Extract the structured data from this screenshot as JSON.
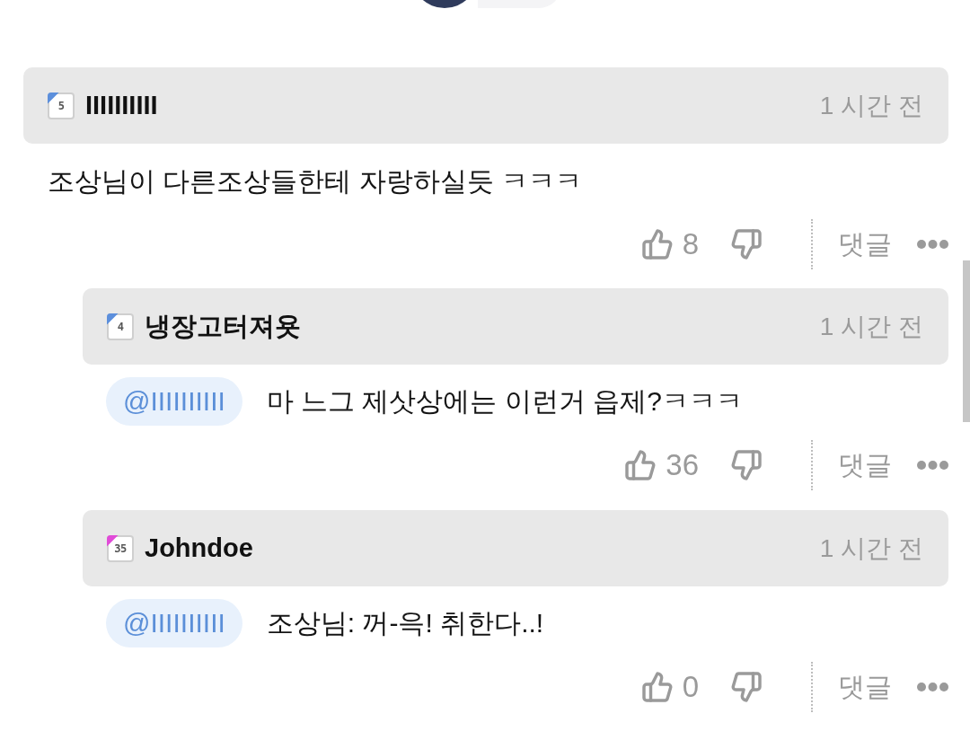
{
  "comments": [
    {
      "author": "IIIIIIIIII",
      "badge": {
        "text": "5",
        "color": "#5c8fdc"
      },
      "time": "1 시간 전",
      "text": "조상님이 다른조상들한테 자랑하실듯 ㅋㅋㅋ",
      "likes": "8",
      "reply_label": "댓글",
      "replies": [
        {
          "author": "냉장고터져욧",
          "badge": {
            "text": "4",
            "color": "#5c8fdc"
          },
          "time": "1 시간 전",
          "mention": "@IIIIIIIIII",
          "text": "마 느그 제삿상에는 이런거 읍제?ㅋㅋㅋ",
          "likes": "36",
          "reply_label": "댓글"
        },
        {
          "author": "Johndoe",
          "badge": {
            "text": "35",
            "color": "#e14bd8"
          },
          "time": "1 시간 전",
          "mention": "@IIIIIIIIII",
          "text": "조상님: 꺼-윽! 취한다..!",
          "likes": "0",
          "reply_label": "댓글"
        }
      ]
    }
  ]
}
